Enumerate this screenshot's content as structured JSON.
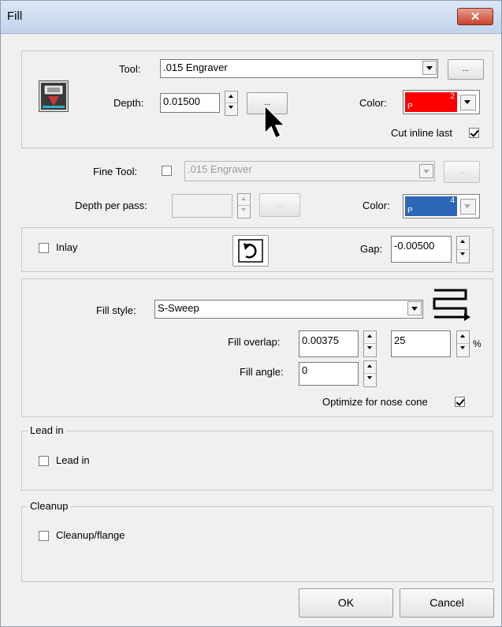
{
  "window": {
    "title": "Fill",
    "close_glyph": "✕"
  },
  "tool_section": {
    "tool_label": "Tool:",
    "tool_value": ".015 Engraver",
    "ellipsis": "...",
    "depth_label": "Depth:",
    "depth_value": "0.01500",
    "color_label": "Color:",
    "color_p": "P",
    "color_num": "2",
    "color_hex": "#ff0000",
    "cut_inline_label": "Cut inline last",
    "cut_inline_checked": true,
    "tool_icon": "engraver-tool-icon"
  },
  "fine_tool_section": {
    "fine_tool_label": "Fine Tool:",
    "fine_tool_value": ".015 Engraver",
    "ellipsis": "...",
    "depth_per_pass_label": "Depth per pass:",
    "depth_per_pass_value": "",
    "color_label": "Color:",
    "color_p": "P",
    "color_num": "4",
    "color_hex": "#2f67b7"
  },
  "inlay_section": {
    "inlay_label": "Inlay",
    "flip_icon": "undo-arrow-icon",
    "gap_label": "Gap:",
    "gap_value": "-0.00500"
  },
  "fill_section": {
    "fill_style_label": "Fill style:",
    "fill_style_value": "S-Sweep",
    "fill_style_icon": "s-sweep-icon",
    "fill_overlap_label": "Fill overlap:",
    "fill_overlap_value": "0.00375",
    "overlap_percent_value": "25",
    "percent_sign": "%",
    "fill_angle_label": "Fill angle:",
    "fill_angle_value": "0",
    "optimize_label": "Optimize for nose cone",
    "optimize_checked": true
  },
  "lead_in_section": {
    "legend": "Lead in",
    "checkbox_label": "Lead in"
  },
  "cleanup_section": {
    "legend": "Cleanup",
    "checkbox_label": "Cleanup/flange"
  },
  "buttons": {
    "ok": "OK",
    "cancel": "Cancel"
  }
}
